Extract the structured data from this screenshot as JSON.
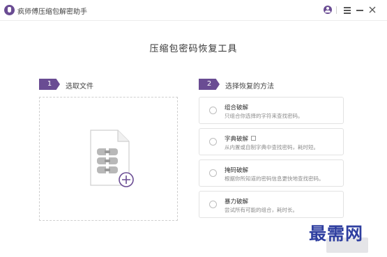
{
  "window": {
    "title": "疯师傅压缩包解密助手"
  },
  "page": {
    "title": "压缩包密码恢复工具"
  },
  "steps": [
    {
      "number": "1",
      "label": "选取文件"
    },
    {
      "number": "2",
      "label": "选择恢复的方法"
    }
  ],
  "methods": [
    {
      "title": "组合破解",
      "desc": "只组合你选择的字符来查找密码。",
      "selected": false
    },
    {
      "title": "字典破解",
      "desc": "从内置或自制字典中查找密码，耗时短。",
      "selected": false
    },
    {
      "title": "掩码破解",
      "desc": "根据你所知道的密码信息更快地查找密码。",
      "selected": false
    },
    {
      "title": "暴力破解",
      "desc": "尝试所有可能的组合，耗时长。",
      "selected": false
    }
  ],
  "watermark": {
    "text": "最需网"
  },
  "colors": {
    "accent": "#6a4c93",
    "watermark": "#2f3fa0"
  }
}
